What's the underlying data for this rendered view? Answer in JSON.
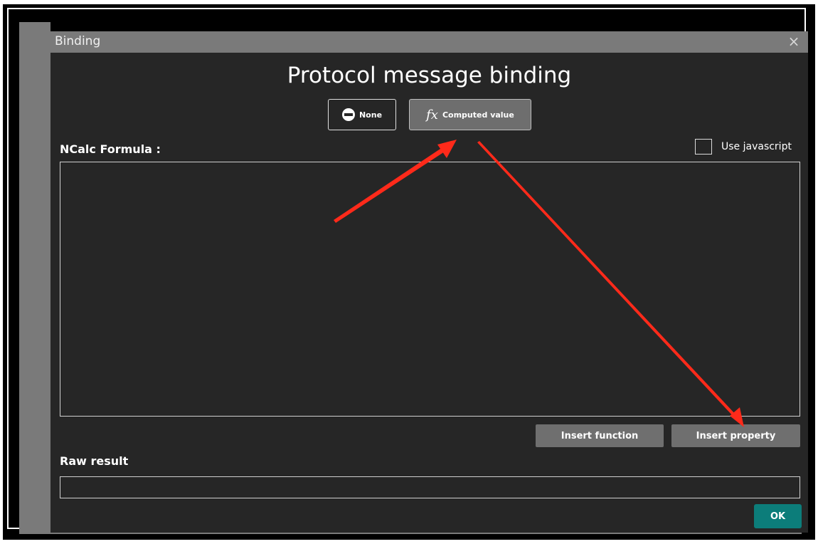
{
  "dialog": {
    "title": "Binding",
    "close_symbol": "×",
    "heading": "Protocol message binding"
  },
  "modes": {
    "none_label": "None",
    "none_icon": "no-entry-icon",
    "computed_label": "Computed value",
    "computed_icon": "fx-icon",
    "computed_glyph": "fx",
    "selected": "Computed value"
  },
  "formula": {
    "label": "NCalc Formula :",
    "value": "",
    "use_javascript_label": "Use javascript",
    "use_javascript_checked": false
  },
  "actions": {
    "insert_function": "Insert function",
    "insert_property": "Insert property"
  },
  "raw_result": {
    "label": "Raw result",
    "value": ""
  },
  "ok_label": "OK",
  "colors": {
    "dialog_bg": "#262626",
    "titlebar": "#7a7a7a",
    "button": "#6f6f6f",
    "ok_teal": "#0c7d7a",
    "annotation_arrow": "#ff2a1a"
  }
}
